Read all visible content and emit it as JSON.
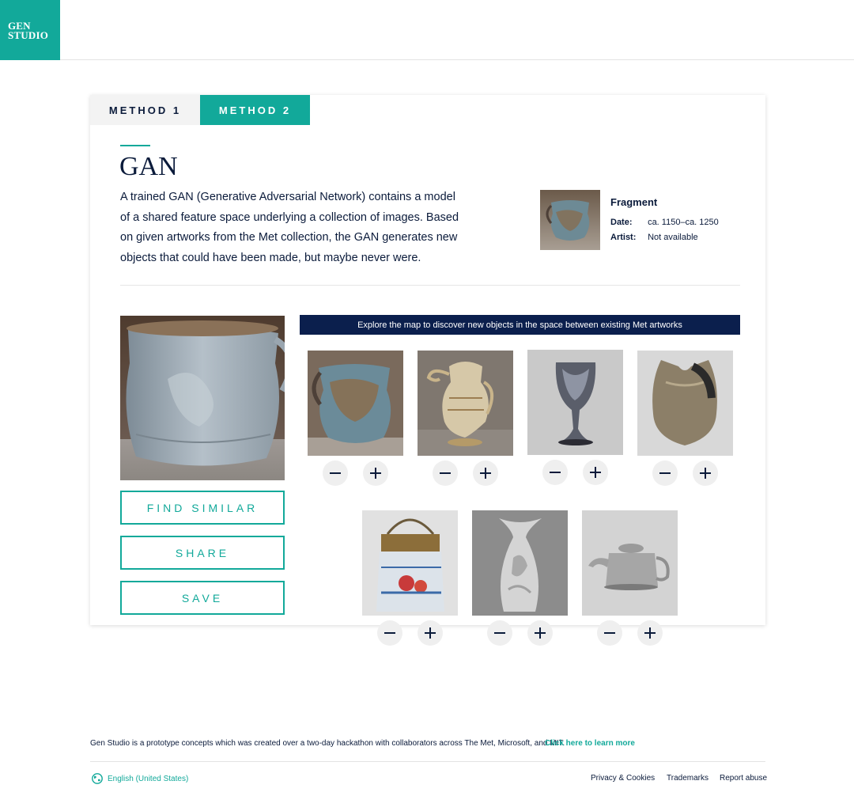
{
  "brand": {
    "line1": "GEN",
    "line2": "STUDIO",
    "color": "#12a99a"
  },
  "tabs": [
    {
      "label": "METHOD 1",
      "active": false
    },
    {
      "label": "METHOD 2",
      "active": true
    }
  ],
  "intro": {
    "title": "GAN",
    "description": "A trained GAN (Generative Adversarial Network) contains a model of a shared feature space underlying a collection of images. Based on given artworks from the Met collection, the GAN generates new objects that could have been made, but maybe never were."
  },
  "artwork_info": {
    "title": "Fragment",
    "date_label": "Date:",
    "date_value": "ca. 1150–ca. 1250",
    "artist_label": "Artist:",
    "artist_value": "Not available"
  },
  "actions": {
    "find_similar": "FIND SIMILAR",
    "share": "SHARE",
    "save": "SAVE"
  },
  "explore_banner": "Explore the map to discover new objects in the space between existing Met artworks",
  "source_objects": [
    {
      "name": "fragment-jar",
      "icon": "jar-image"
    },
    {
      "name": "ewer",
      "icon": "ewer-image"
    },
    {
      "name": "goblet",
      "icon": "goblet-image"
    },
    {
      "name": "armor-breastplate",
      "icon": "armor-image"
    },
    {
      "name": "beaded-bag",
      "icon": "bag-image"
    },
    {
      "name": "vase",
      "icon": "vase-image"
    },
    {
      "name": "teapot",
      "icon": "teapot-image"
    }
  ],
  "footer": {
    "text": "Gen Studio is a prototype concepts which was created over a two-day hackathon with collaborators across The Met, Microsoft, and MIT.",
    "learn_more": "Click here to learn more",
    "language": "English (United States)",
    "privacy": "Privacy & Cookies",
    "trademarks": "Trademarks",
    "report": "Report abuse"
  },
  "colors": {
    "accent": "#12a99a",
    "navy": "#0b1f4d",
    "text": "#0b1b3b"
  }
}
